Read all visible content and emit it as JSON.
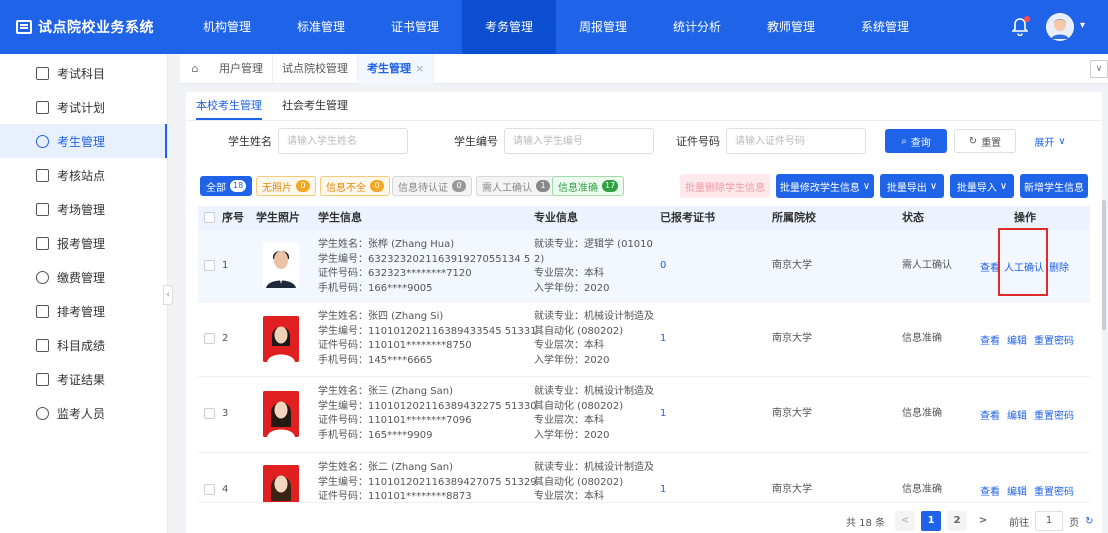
{
  "app": {
    "title": "试点院校业务系统"
  },
  "nav": [
    "机构管理",
    "标准管理",
    "证书管理",
    "考务管理",
    "周报管理",
    "统计分析",
    "教师管理",
    "系统管理"
  ],
  "nav_active_index": 3,
  "sidebar": {
    "items": [
      "考试科目",
      "考试计划",
      "考生管理",
      "考核站点",
      "考场管理",
      "报考管理",
      "缴费管理",
      "排考管理",
      "科目成绩",
      "考证结果",
      "监考人员"
    ],
    "active_index": 2
  },
  "tabs": [
    "用户管理",
    "试点院校管理",
    "考生管理"
  ],
  "tab_close": "×",
  "subtabs": [
    "本校考生管理",
    "社会考生管理"
  ],
  "filters": {
    "name_label": "学生姓名",
    "name_placeholder": "请输入学生姓名",
    "id_label": "学生编号",
    "id_placeholder": "请输入学生编号",
    "cert_label": "证件号码",
    "cert_placeholder": "请输入证件号码",
    "search": "查询",
    "reset": "重置",
    "expand": "展开"
  },
  "chips": [
    {
      "label": "全部",
      "count": "18"
    },
    {
      "label": "无照片",
      "count": "0"
    },
    {
      "label": "信息不全",
      "count": "0"
    },
    {
      "label": "信息待认证",
      "count": "0"
    },
    {
      "label": "需人工确认",
      "count": "1"
    },
    {
      "label": "信息准确",
      "count": "17"
    }
  ],
  "actions": {
    "batch_delete": "批量删除学生信息",
    "batch_edit": "批量修改学生信息",
    "batch_export": "批量导出",
    "batch_import": "批量导入",
    "add": "新增学生信息"
  },
  "columns": [
    "序号",
    "学生照片",
    "学生信息",
    "专业信息",
    "已报考证书",
    "所属院校",
    "状态",
    "操作"
  ],
  "rows": [
    {
      "no": "1",
      "info": [
        "学生姓名：张桦 (Zhang Hua)",
        "学生编号：632323202116391927055134 5",
        "证件号码：632323********7120",
        "手机号码：166****9005"
      ],
      "major": [
        "就读专业：逻辑学 (01010",
        "2)",
        "专业层次：本科",
        "入学年份：2020"
      ],
      "certs": "0",
      "school": "南京大学",
      "status": "需人工确认",
      "ops": [
        "查看",
        "人工确认",
        "删除"
      ]
    },
    {
      "no": "2",
      "info": [
        "学生姓名：张四 (Zhang Si)",
        "学生编号：110101202116389433545 51331",
        "证件号码：110101********8750",
        "手机号码：145****6665"
      ],
      "major": [
        "就读专业：机械设计制造及",
        "其自动化 (080202)",
        "专业层次：本科",
        "入学年份：2020"
      ],
      "certs": "1",
      "school": "南京大学",
      "status": "信息准确",
      "ops": [
        "查看",
        "编辑",
        "重置密码"
      ]
    },
    {
      "no": "3",
      "info": [
        "学生姓名：张三 (Zhang San)",
        "学生编号：110101202116389432275 51330",
        "证件号码：110101********7096",
        "手机号码：165****9909"
      ],
      "major": [
        "就读专业：机械设计制造及",
        "其自动化 (080202)",
        "专业层次：本科",
        "入学年份：2020"
      ],
      "certs": "1",
      "school": "南京大学",
      "status": "信息准确",
      "ops": [
        "查看",
        "编辑",
        "重置密码"
      ]
    },
    {
      "no": "4",
      "info": [
        "学生姓名：张二 (Zhang San)",
        "学生编号：110101202116389427075 51329",
        "证件号码：110101********8873",
        ""
      ],
      "major": [
        "就读专业：机械设计制造及",
        "其自动化 (080202)",
        "专业层次：本科",
        ""
      ],
      "certs": "1",
      "school": "南京大学",
      "status": "信息准确",
      "ops": [
        "查看",
        "编辑",
        "重置密码"
      ]
    }
  ],
  "pager": {
    "total": "共 18 条",
    "pages": [
      "1",
      "2"
    ],
    "goto": "前往",
    "page_unit": "页",
    "current": "1",
    "prev": "<",
    "next": ">"
  },
  "colors": {
    "primary": "#1f63e8",
    "highlight_box": "#e02b2b"
  }
}
